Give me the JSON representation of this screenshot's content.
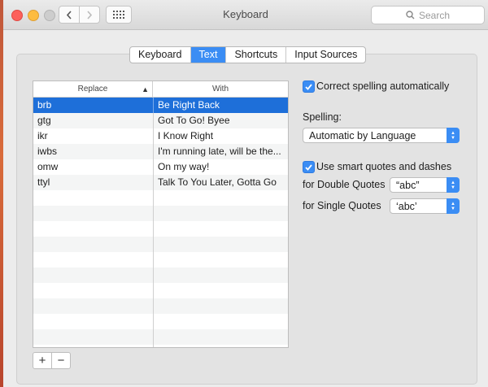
{
  "window": {
    "title": "Keyboard"
  },
  "search": {
    "placeholder": "Search"
  },
  "tabs": [
    {
      "label": "Keyboard",
      "active": false
    },
    {
      "label": "Text",
      "active": true
    },
    {
      "label": "Shortcuts",
      "active": false
    },
    {
      "label": "Input Sources",
      "active": false
    }
  ],
  "table": {
    "headers": {
      "replace": "Replace",
      "with": "With"
    },
    "rows": [
      {
        "replace": "brb",
        "with": "Be Right Back",
        "selected": true
      },
      {
        "replace": "gtg",
        "with": "Got To Go! Byee"
      },
      {
        "replace": "ikr",
        "with": "I Know Right"
      },
      {
        "replace": "iwbs",
        "with": "I'm running late, will be the..."
      },
      {
        "replace": "omw",
        "with": "On my way!"
      },
      {
        "replace": "ttyl",
        "with": "Talk To You Later, Gotta Go"
      }
    ]
  },
  "controls": {
    "add_label": "+",
    "remove_label": "−"
  },
  "options": {
    "correct_spelling": {
      "label": "Correct spelling automatically",
      "checked": true
    },
    "spelling_label": "Spelling:",
    "spelling_value": "Automatic by Language",
    "smart_quotes": {
      "label": "Use smart quotes and dashes",
      "checked": true
    },
    "double_quotes_label": "for Double Quotes",
    "double_quotes_value": "“abc”",
    "single_quotes_label": "for Single Quotes",
    "single_quotes_value": "‘abc’"
  },
  "colors": {
    "accent": "#3b8df4",
    "selection": "#1e6fd9"
  }
}
